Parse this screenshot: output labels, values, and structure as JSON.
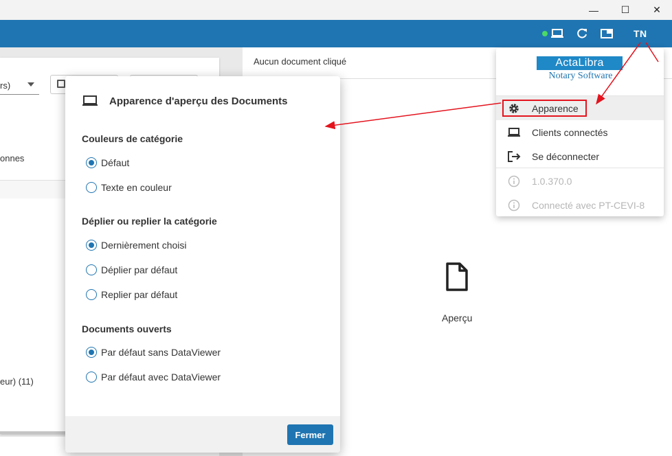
{
  "window": {
    "minimize": "—",
    "maximize": "☐",
    "close": "✕"
  },
  "header": {
    "user_initials": "TN",
    "status_color": "#4cd964",
    "brand_color": "#1f75b1",
    "icons": [
      "computer-icon",
      "refresh-icon",
      "window-icon"
    ]
  },
  "left_panel": {
    "select_fragment": "rs)",
    "columns_fragment": "onnes",
    "category_fragment": "eur) (11)"
  },
  "preview": {
    "header": "Aucun document cliqué",
    "placeholder_label": "Aperçu"
  },
  "dialog": {
    "title": "Apparence d'aperçu des Documents",
    "sections": [
      {
        "heading": "Couleurs de catégorie",
        "options": [
          {
            "label": "Défaut",
            "checked": true
          },
          {
            "label": "Texte en couleur",
            "checked": false
          }
        ]
      },
      {
        "heading": "Déplier ou replier la catégorie",
        "options": [
          {
            "label": "Dernièrement choisi",
            "checked": true
          },
          {
            "label": "Déplier par défaut",
            "checked": false
          },
          {
            "label": "Replier par défaut",
            "checked": false
          }
        ]
      },
      {
        "heading": "Documents ouverts",
        "options": [
          {
            "label": "Par défaut sans DataViewer",
            "checked": true
          },
          {
            "label": "Par défaut avec DataViewer",
            "checked": false
          }
        ]
      }
    ],
    "close_label": "Fermer"
  },
  "menu": {
    "logo_name": "ActaLibra",
    "logo_tagline": "Notary Software",
    "items": [
      {
        "label": "Apparence",
        "icon": "gear-icon"
      },
      {
        "label": "Clients connectés",
        "icon": "laptop-icon"
      },
      {
        "label": "Se déconnecter",
        "icon": "logout-icon"
      }
    ],
    "version": "1.0.370.0",
    "connected_label": "Connecté avec PT-CEVI-8"
  },
  "annotation_color": "#e3131d"
}
